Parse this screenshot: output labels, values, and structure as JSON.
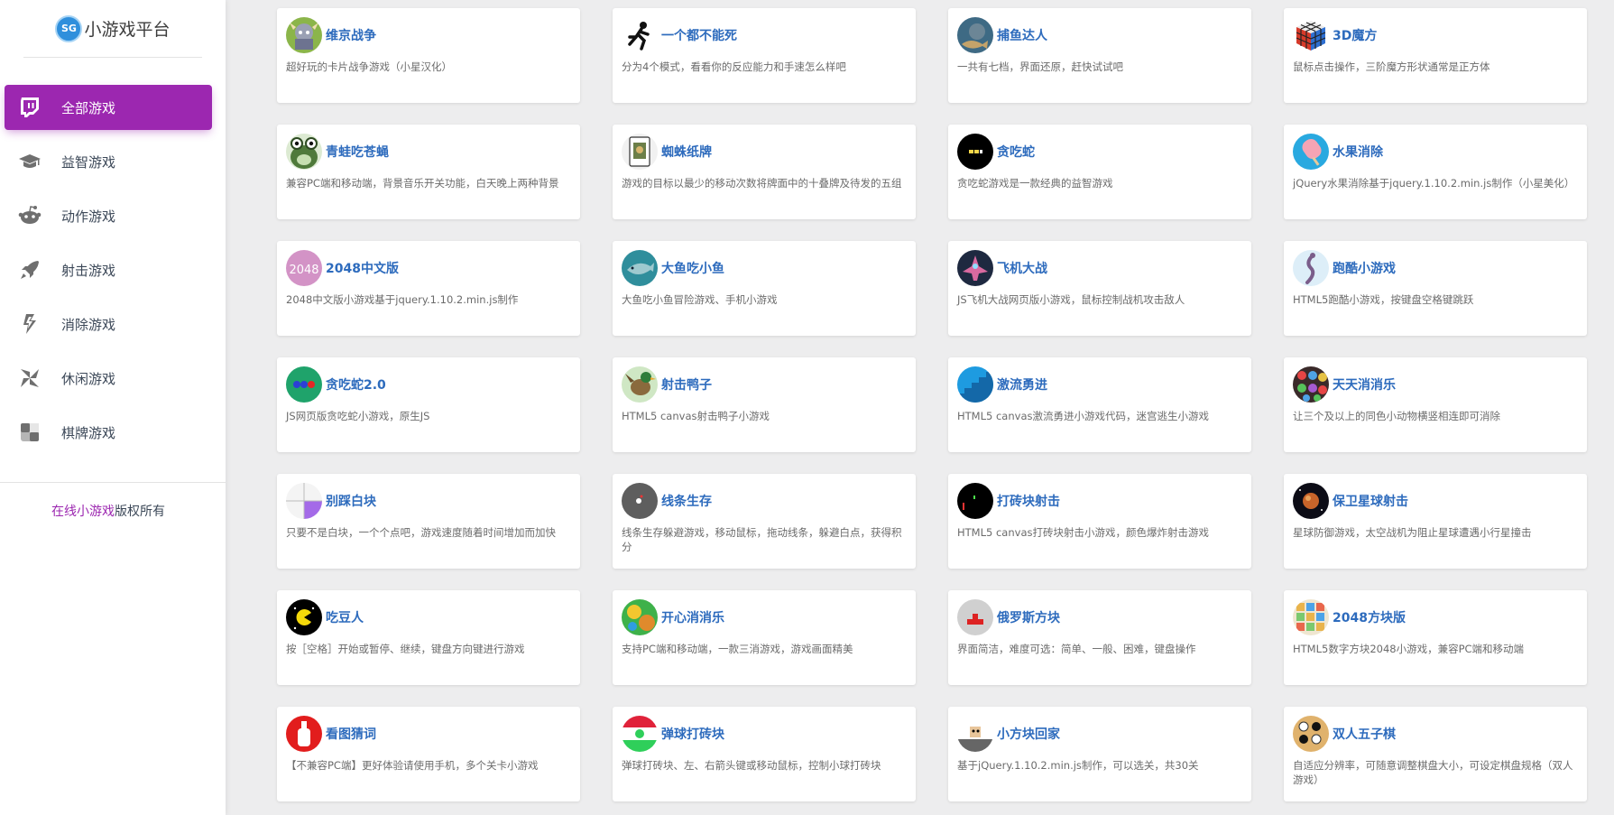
{
  "brand": {
    "logo_text": "SG",
    "title": "小游戏平台"
  },
  "nav": [
    {
      "label": "全部游戏",
      "icon": "twitch-icon"
    },
    {
      "label": "益智游戏",
      "icon": "graduation-cap-icon"
    },
    {
      "label": "动作游戏",
      "icon": "robot-face-icon"
    },
    {
      "label": "射击游戏",
      "icon": "rocket-icon"
    },
    {
      "label": "消除游戏",
      "icon": "lightning-icon"
    },
    {
      "label": "休闲游戏",
      "icon": "pinwheel-icon"
    },
    {
      "label": "棋牌游戏",
      "icon": "checker-icon"
    }
  ],
  "footer": {
    "link_text": "在线小游戏",
    "suffix": "版权所有"
  },
  "games": [
    {
      "title": "维京战争",
      "desc": "超好玩的卡片战争游戏（小星汉化）",
      "icon": "viking-icon"
    },
    {
      "title": "一个都不能死",
      "desc": "分为4个模式，看看你的反应能力和手速怎么样吧",
      "icon": "running-man-icon"
    },
    {
      "title": "捕鱼达人",
      "desc": "一共有七档，界面还原，赶快试试吧",
      "icon": "fishing-icon"
    },
    {
      "title": "3D魔方",
      "desc": "鼠标点击操作，三阶魔方形状通常是正方体",
      "icon": "rubiks-cube-icon"
    },
    {
      "title": "青蛙吃苍蝇",
      "desc": "兼容PC端和移动端，背景音乐开关功能，白天晚上两种背景",
      "icon": "frog-icon"
    },
    {
      "title": "蜘蛛纸牌",
      "desc": "游戏的目标以最少的移动次数将牌面中的十叠牌及待发的五组",
      "icon": "playing-card-icon"
    },
    {
      "title": "贪吃蛇",
      "desc": "贪吃蛇游戏是一款经典的益智游戏",
      "icon": "snake-icon"
    },
    {
      "title": "水果消除",
      "desc": "jQuery水果消除基于jquery.1.10.2.min.js制作（小星美化）",
      "icon": "popsicle-icon"
    },
    {
      "title": "2048中文版",
      "desc": "2048中文版小游戏基于jquery.1.10.2.min.js制作",
      "icon": "tile-2048-icon"
    },
    {
      "title": "大鱼吃小鱼",
      "desc": "大鱼吃小鱼冒险游戏、手机小游戏",
      "icon": "shark-icon"
    },
    {
      "title": "飞机大战",
      "desc": "JS飞机大战网页版小游戏，鼠标控制战机攻击敌人",
      "icon": "spaceship-icon"
    },
    {
      "title": "跑酷小游戏",
      "desc": "HTML5跑酷小游戏，按键盘空格键跳跃",
      "icon": "parkour-icon"
    },
    {
      "title": "贪吃蛇2.0",
      "desc": "JS网页版贪吃蛇小游戏，原生JS",
      "icon": "snake-dots-icon"
    },
    {
      "title": "射击鸭子",
      "desc": "HTML5 canvas射击鸭子小游戏",
      "icon": "duck-icon"
    },
    {
      "title": "激流勇进",
      "desc": "HTML5 canvas激流勇进小游戏代码，迷宫逃生小游戏",
      "icon": "stairs-icon"
    },
    {
      "title": "天天消消乐",
      "desc": "让三个及以上的同色小动物横竖相连即可消除",
      "icon": "animals-grid-icon"
    },
    {
      "title": "别踩白块",
      "desc": "只要不是白块，一个个点吧，游戏速度随着时间增加而加快",
      "icon": "white-tile-icon"
    },
    {
      "title": "线条生存",
      "desc": "线条生存躲避游戏，移动鼠标，拖动线条，躲避白点，获得积分",
      "icon": "dark-circle-icon"
    },
    {
      "title": "打砖块射击",
      "desc": "HTML5 canvas打砖块射击小游戏，颜色爆炸射击游戏",
      "icon": "brick-shooter-icon"
    },
    {
      "title": "保卫星球射击",
      "desc": "星球防御游戏，太空战机为阻止星球遭遇小行星撞击",
      "icon": "planet-icon"
    },
    {
      "title": "吃豆人",
      "desc": "按［空格］开始或暂停、继续，键盘方向键进行游戏",
      "icon": "pacman-icon"
    },
    {
      "title": "开心消消乐",
      "desc": "支持PC端和移动端，一款三消游戏，游戏画面精美",
      "icon": "happy-match-icon"
    },
    {
      "title": "俄罗斯方块",
      "desc": "界面简洁，难度可选：简单、一般、困难，键盘操作",
      "icon": "tetris-icon"
    },
    {
      "title": "2048方块版",
      "desc": "HTML5数字方块2048小游戏，兼容PC端和移动端",
      "icon": "colored-blocks-icon"
    },
    {
      "title": "看图猜词",
      "desc": "【不兼容PC端】更好体验请使用手机，多个关卡小游戏",
      "icon": "bottle-icon"
    },
    {
      "title": "弹球打砖块",
      "desc": "弹球打砖块、左、右箭头键或移动鼠标，控制小球打砖块",
      "icon": "pinball-icon"
    },
    {
      "title": "小方块回家",
      "desc": "基于jQuery.1.10.2.min.js制作，可以选关，共30关",
      "icon": "little-block-icon"
    },
    {
      "title": "双人五子棋",
      "desc": "自适应分辨率，可随意调整棋盘大小，可设定棋盘规格（双人游戏）",
      "icon": "gomoku-icon"
    }
  ]
}
